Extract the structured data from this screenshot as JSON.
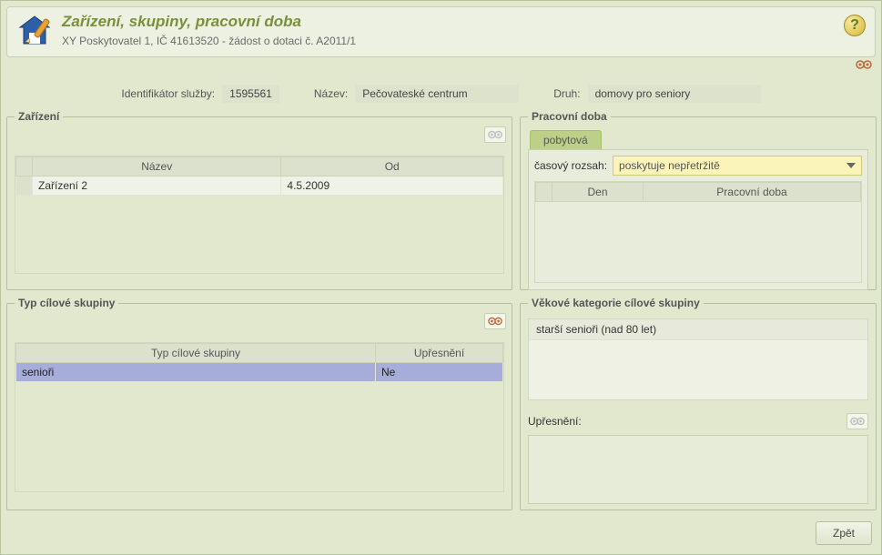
{
  "header": {
    "title": "Zařízení, skupiny, pracovní doba",
    "subtitle": "XY Poskytovatel 1, IČ 41613520 - žádost o dotaci č. A2011/1"
  },
  "service": {
    "id_label": "Identifikátor služby:",
    "id_value": "1595561",
    "name_label": "Název:",
    "name_value": "Pečovateské centrum",
    "type_label": "Druh:",
    "type_value": "domovy pro seniory"
  },
  "zarizeni": {
    "legend": "Zařízení",
    "cols": {
      "name": "Název",
      "od": "Od"
    },
    "rows": [
      {
        "name": "Zařízení 2",
        "od": "4.5.2009"
      }
    ]
  },
  "pracdoba": {
    "legend": "Pracovní doba",
    "tab": "pobytová",
    "casovy_label": "časový rozsah:",
    "casovy_value": "poskytuje nepřetržitě",
    "cols": {
      "den": "Den",
      "pd": "Pracovní doba"
    }
  },
  "typcil": {
    "legend": "Typ cílové skupiny",
    "cols": {
      "typ": "Typ cílové skupiny",
      "upres": "Upřesnění"
    },
    "rows": [
      {
        "typ": "senioři",
        "upres": "Ne"
      }
    ]
  },
  "vekove": {
    "legend": "Věkové kategorie cílové skupiny",
    "items": [
      "starší senioři (nad 80 let)"
    ],
    "upresneni_label": "Upřesnění:"
  },
  "buttons": {
    "back": "Zpět"
  }
}
